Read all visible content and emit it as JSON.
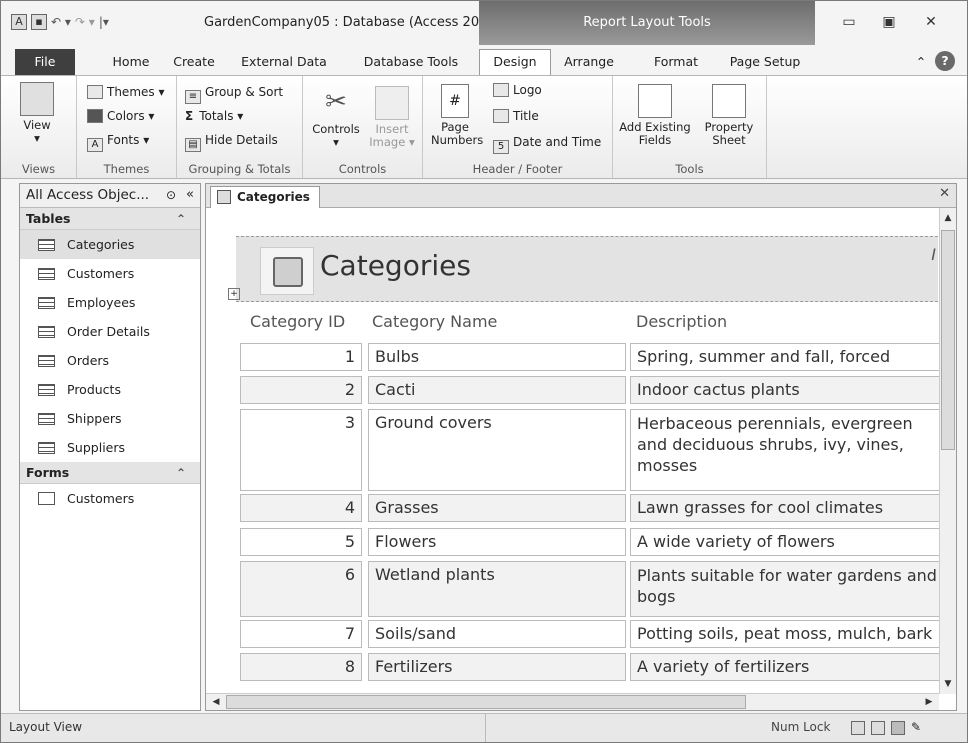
{
  "app": {
    "window_title": "GardenCompany05 : Database (Access 20...",
    "context_title": "Report Layout Tools"
  },
  "tabs": [
    "File",
    "Home",
    "Create",
    "External Data",
    "Database Tools",
    "Design",
    "Arrange",
    "Format",
    "Page Setup"
  ],
  "ribbon": {
    "views": {
      "view_label": "View",
      "group_label": "Views"
    },
    "themes": {
      "themes_label": "Themes",
      "colors_label": "Colors",
      "fonts_label": "Fonts",
      "group_label": "Themes"
    },
    "grouping": {
      "group_sort_label": "Group & Sort",
      "totals_label": "Totals",
      "hide_details_label": "Hide Details",
      "group_label": "Grouping & Totals"
    },
    "controls": {
      "controls_label": "Controls",
      "insert_image_label": "Insert Image",
      "group_label": "Controls"
    },
    "header_footer": {
      "page_numbers_label": "Page Numbers",
      "logo_label": "Logo",
      "title_label": "Title",
      "date_time_label": "Date and Time",
      "group_label": "Header / Footer"
    },
    "tools": {
      "add_fields_label": "Add Existing Fields",
      "property_sheet_label": "Property Sheet",
      "group_label": "Tools"
    }
  },
  "nav": {
    "header": "All Access Objec...",
    "sections": [
      {
        "title": "Tables",
        "items": [
          "Categories",
          "Customers",
          "Employees",
          "Order Details",
          "Orders",
          "Products",
          "Shippers",
          "Suppliers"
        ]
      },
      {
        "title": "Forms",
        "items": [
          "Customers"
        ]
      }
    ]
  },
  "document": {
    "tab_label": "Categories",
    "report_title": "Categories",
    "header_mark": "I",
    "columns": [
      "Category ID",
      "Category Name",
      "Description"
    ],
    "rows": [
      {
        "id": "1",
        "name": "Bulbs",
        "desc": "Spring, summer and fall, forced"
      },
      {
        "id": "2",
        "name": "Cacti",
        "desc": "Indoor cactus plants"
      },
      {
        "id": "3",
        "name": "Ground covers",
        "desc": "Herbaceous perennials, evergreen and deciduous shrubs, ivy, vines, mosses"
      },
      {
        "id": "4",
        "name": "Grasses",
        "desc": "Lawn grasses for cool climates"
      },
      {
        "id": "5",
        "name": "Flowers",
        "desc": "A wide variety of flowers"
      },
      {
        "id": "6",
        "name": "Wetland plants",
        "desc": "Plants suitable for water gardens and bogs"
      },
      {
        "id": "7",
        "name": "Soils/sand",
        "desc": "Potting soils, peat moss, mulch, bark"
      },
      {
        "id": "8",
        "name": "Fertilizers",
        "desc": "A variety of fertilizers"
      }
    ]
  },
  "status": {
    "left": "Layout View",
    "num_lock": "Num Lock"
  }
}
